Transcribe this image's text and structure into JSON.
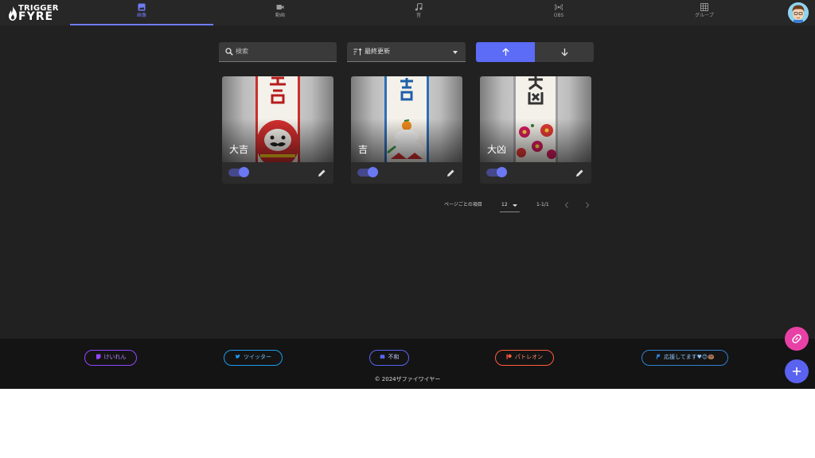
{
  "app": {
    "logo_line1": "TRIGGER",
    "logo_line2": "FYRE"
  },
  "nav": {
    "tabs": [
      {
        "label": "画像",
        "icon": "image-icon",
        "active": true
      },
      {
        "label": "動画",
        "icon": "video-icon",
        "active": false
      },
      {
        "label": "音",
        "icon": "music-note-icon",
        "active": false
      },
      {
        "label": "OBS",
        "icon": "broadcast-icon",
        "active": false
      },
      {
        "label": "グループ",
        "icon": "grid-icon",
        "active": false
      }
    ],
    "active_color": "#6e7cf5"
  },
  "controls": {
    "search_placeholder": "検索",
    "sort_value": "最終更新",
    "sort_direction": "ascending",
    "accent": "#5c6cf7"
  },
  "cards": [
    {
      "caption": "大吉",
      "enabled": true
    },
    {
      "caption": "吉",
      "enabled": true
    },
    {
      "caption": "大凶",
      "enabled": true
    }
  ],
  "pagination": {
    "items_per_page_label": "ページごとの項目",
    "items_per_page": "12",
    "range": "1-1/1"
  },
  "footer": {
    "links": [
      {
        "label": "けいれん",
        "color": "#9146ff",
        "icon": "twitch-icon"
      },
      {
        "label": "ツイッター",
        "color": "#1d9bf0",
        "icon": "twitter-icon"
      },
      {
        "label": "不和",
        "color": "#5865f2",
        "icon": "discord-icon"
      },
      {
        "label": "パトレオン",
        "color": "#ff5a3c",
        "icon": "patreon-icon"
      },
      {
        "label": "応援してます♥😊🍩",
        "color": "#2f80d1",
        "icon": "paypal-icon"
      }
    ],
    "copyright": "© 2024ザファイワイヤー"
  },
  "fabs": {
    "link_color": "#e940a6",
    "add_color": "#5a62f0"
  }
}
